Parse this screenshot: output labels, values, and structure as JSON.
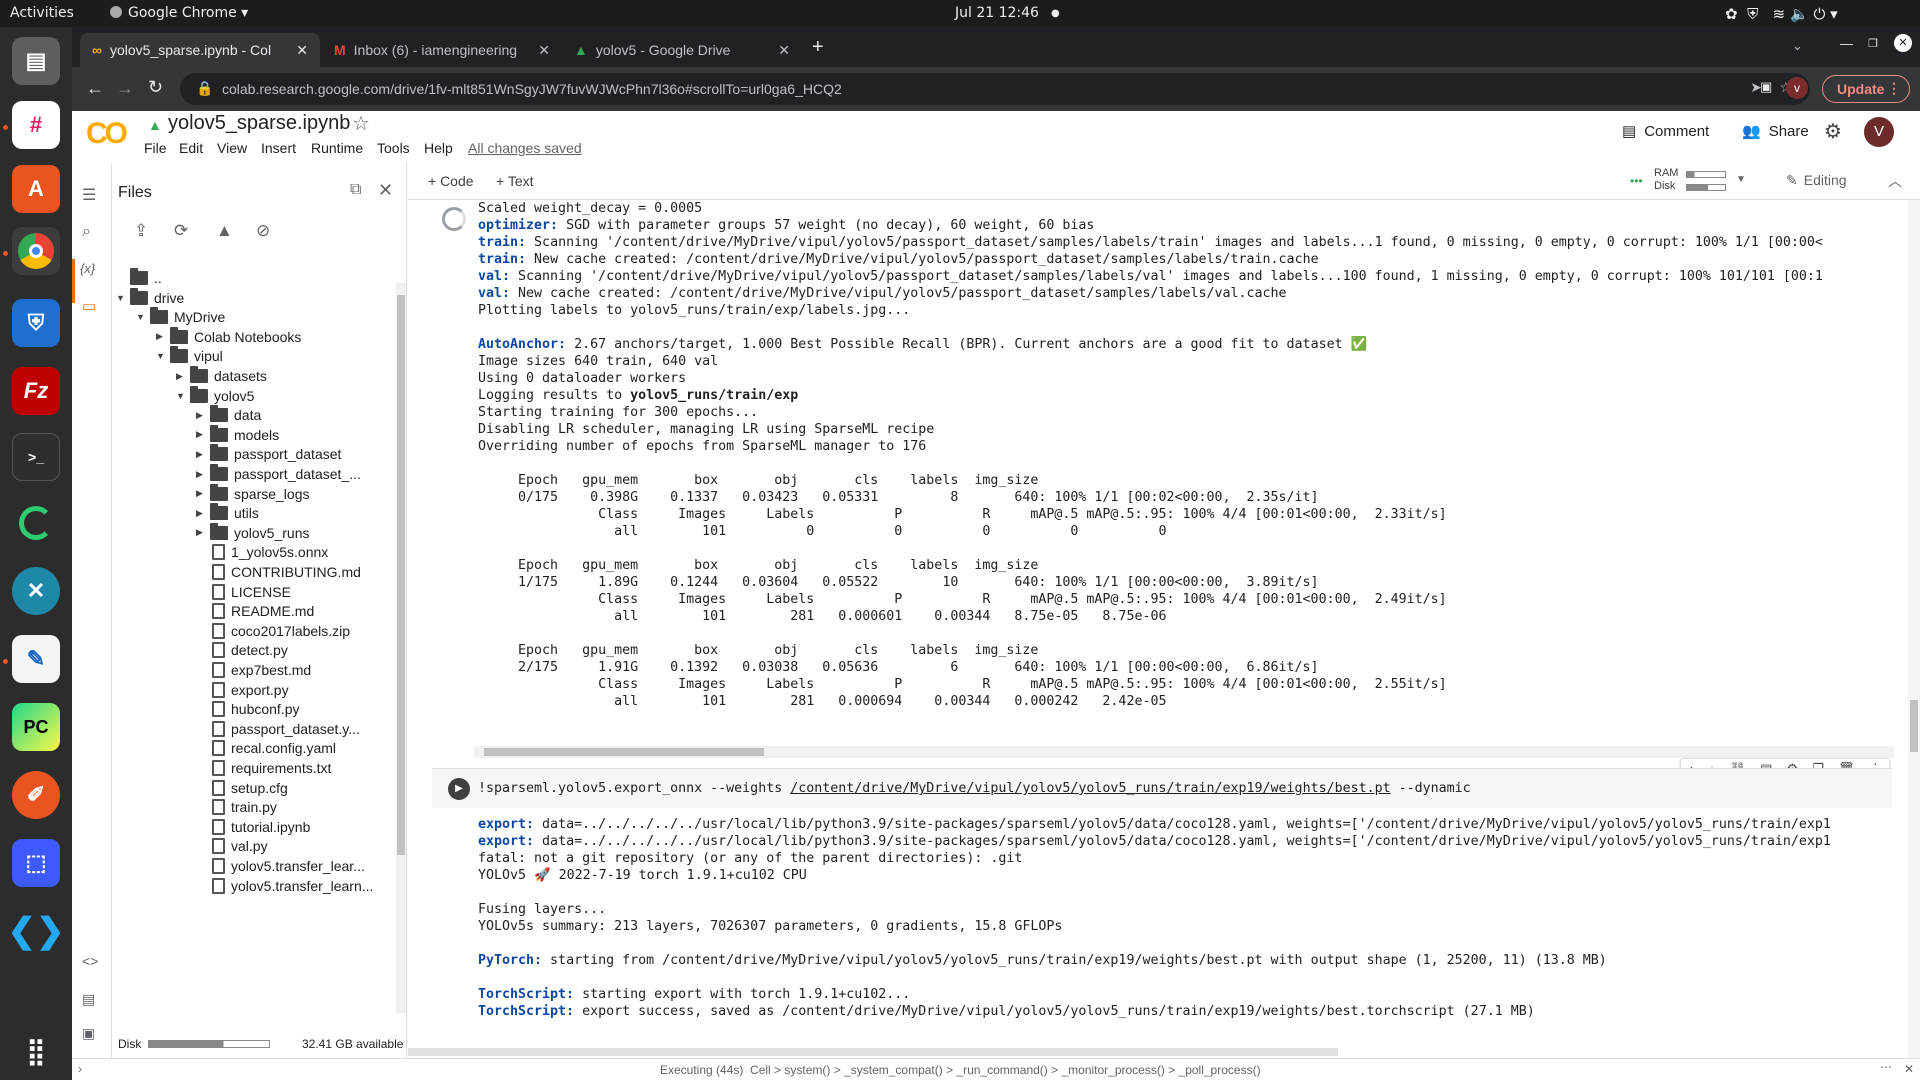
{
  "system_bar": {
    "activities": "Activities",
    "app_name": "Google Chrome",
    "datetime": "Jul 21  12:46"
  },
  "browser": {
    "tabs": [
      {
        "label": "yolov5_sparse.ipynb - Col",
        "icon": "colab-icon",
        "active": true
      },
      {
        "label": "Inbox (6) - iamengineering",
        "icon": "gmail-icon",
        "active": false
      },
      {
        "label": "yolov5 - Google Drive",
        "icon": "drive-icon",
        "active": false
      }
    ],
    "url": "colab.research.google.com/drive/1fv-mlt851WnSgyJW7fuvWJWcPhn7l36o#scrollTo=url0ga6_HCQ2",
    "update_label": "Update",
    "profile_initial": "v"
  },
  "colab": {
    "logo": "CO",
    "notebook_title": "yolov5_sparse.ipynb",
    "menu": [
      "File",
      "Edit",
      "View",
      "Insert",
      "Runtime",
      "Tools",
      "Help"
    ],
    "saved_status": "All changes saved",
    "comment_label": "Comment",
    "share_label": "Share",
    "avatar_initial": "V",
    "add_code": "+ Code",
    "add_text": "+ Text",
    "ram_label": "RAM",
    "disk_label": "Disk",
    "editing_label": "Editing"
  },
  "files_panel": {
    "title": "Files",
    "tree": [
      {
        "label": "..",
        "depth": 0,
        "type": "up"
      },
      {
        "label": "drive",
        "depth": 0,
        "type": "folder",
        "open": true
      },
      {
        "label": "MyDrive",
        "depth": 1,
        "type": "folder",
        "open": true
      },
      {
        "label": "Colab Notebooks",
        "depth": 2,
        "type": "folder",
        "open": false
      },
      {
        "label": "vipul",
        "depth": 2,
        "type": "folder",
        "open": true
      },
      {
        "label": "datasets",
        "depth": 3,
        "type": "folder",
        "open": false
      },
      {
        "label": "yolov5",
        "depth": 3,
        "type": "folder",
        "open": true
      },
      {
        "label": "data",
        "depth": 4,
        "type": "folder",
        "open": false
      },
      {
        "label": "models",
        "depth": 4,
        "type": "folder",
        "open": false
      },
      {
        "label": "passport_dataset",
        "depth": 4,
        "type": "folder",
        "open": false
      },
      {
        "label": "passport_dataset_...",
        "depth": 4,
        "type": "folder",
        "open": false
      },
      {
        "label": "sparse_logs",
        "depth": 4,
        "type": "folder",
        "open": false
      },
      {
        "label": "utils",
        "depth": 4,
        "type": "folder",
        "open": false
      },
      {
        "label": "yolov5_runs",
        "depth": 4,
        "type": "folder",
        "open": false
      },
      {
        "label": "1_yolov5s.onnx",
        "depth": 4,
        "type": "file"
      },
      {
        "label": "CONTRIBUTING.md",
        "depth": 4,
        "type": "file"
      },
      {
        "label": "LICENSE",
        "depth": 4,
        "type": "file"
      },
      {
        "label": "README.md",
        "depth": 4,
        "type": "file"
      },
      {
        "label": "coco2017labels.zip",
        "depth": 4,
        "type": "file"
      },
      {
        "label": "detect.py",
        "depth": 4,
        "type": "file"
      },
      {
        "label": "exp7best.md",
        "depth": 4,
        "type": "file"
      },
      {
        "label": "export.py",
        "depth": 4,
        "type": "file"
      },
      {
        "label": "hubconf.py",
        "depth": 4,
        "type": "file"
      },
      {
        "label": "passport_dataset.y...",
        "depth": 4,
        "type": "file"
      },
      {
        "label": "recal.config.yaml",
        "depth": 4,
        "type": "file"
      },
      {
        "label": "requirements.txt",
        "depth": 4,
        "type": "file"
      },
      {
        "label": "setup.cfg",
        "depth": 4,
        "type": "file"
      },
      {
        "label": "train.py",
        "depth": 4,
        "type": "file"
      },
      {
        "label": "tutorial.ipynb",
        "depth": 4,
        "type": "file"
      },
      {
        "label": "val.py",
        "depth": 4,
        "type": "file"
      },
      {
        "label": "yolov5.transfer_lear...",
        "depth": 4,
        "type": "file"
      },
      {
        "label": "yolov5.transfer_learn...",
        "depth": 4,
        "type": "file"
      }
    ],
    "disk_label": "Disk",
    "disk_free": "32.41 GB available"
  },
  "output1": [
    {
      "k": "",
      "t": "Scaled weight_decay = 0.0005"
    },
    {
      "k": "optimizer:",
      "t": " SGD with parameter groups 57 weight (no decay), 60 weight, 60 bias"
    },
    {
      "k": "train:",
      "t": " Scanning '/content/drive/MyDrive/vipul/yolov5/passport_dataset/samples/labels/train' images and labels...1 found, 0 missing, 0 empty, 0 corrupt: 100% 1/1 [00:00<"
    },
    {
      "k": "train:",
      "t": " New cache created: /content/drive/MyDrive/vipul/yolov5/passport_dataset/samples/labels/train.cache"
    },
    {
      "k": "val:",
      "t": " Scanning '/content/drive/MyDrive/vipul/yolov5/passport_dataset/samples/labels/val' images and labels...100 found, 1 missing, 0 empty, 0 corrupt: 100% 101/101 [00:1"
    },
    {
      "k": "val:",
      "t": " New cache created: /content/drive/MyDrive/vipul/yolov5/passport_dataset/samples/labels/val.cache"
    },
    {
      "k": "",
      "t": "Plotting labels to yolov5_runs/train/exp/labels.jpg..."
    },
    {
      "k": "",
      "t": ""
    },
    {
      "k": "AutoAnchor:",
      "t": " 2.67 anchors/target, 1.000 Best Possible Recall (BPR). Current anchors are a good fit to dataset ✅"
    },
    {
      "k": "",
      "t": "Image sizes 640 train, 640 val"
    },
    {
      "k": "",
      "t": "Using 0 dataloader workers"
    },
    {
      "k": "",
      "t": "Logging results to ",
      "b": "yolov5_runs/train/exp"
    },
    {
      "k": "",
      "t": "Starting training for 300 epochs..."
    },
    {
      "k": "",
      "t": "Disabling LR scheduler, managing LR using SparseML recipe"
    },
    {
      "k": "",
      "t": "Overriding number of epochs from SparseML manager to 176"
    },
    {
      "k": "",
      "t": ""
    },
    {
      "k": "",
      "t": "     Epoch   gpu_mem       box       obj       cls    labels  img_size"
    },
    {
      "k": "",
      "t": "     0/175    0.398G    0.1337   0.03423   0.05331         8       640: 100% 1/1 [00:02<00:00,  2.35s/it]"
    },
    {
      "k": "",
      "t": "               Class     Images     Labels          P          R     mAP@.5 mAP@.5:.95: 100% 4/4 [00:01<00:00,  2.33it/s]"
    },
    {
      "k": "",
      "t": "                 all        101          0          0          0          0          0"
    },
    {
      "k": "",
      "t": ""
    },
    {
      "k": "",
      "t": "     Epoch   gpu_mem       box       obj       cls    labels  img_size"
    },
    {
      "k": "",
      "t": "     1/175     1.89G    0.1244   0.03604   0.05522        10       640: 100% 1/1 [00:00<00:00,  3.89it/s]"
    },
    {
      "k": "",
      "t": "               Class     Images     Labels          P          R     mAP@.5 mAP@.5:.95: 100% 4/4 [00:01<00:00,  2.49it/s]"
    },
    {
      "k": "",
      "t": "                 all        101        281   0.000601    0.00344   8.75e-05   8.75e-06"
    },
    {
      "k": "",
      "t": ""
    },
    {
      "k": "",
      "t": "     Epoch   gpu_mem       box       obj       cls    labels  img_size"
    },
    {
      "k": "",
      "t": "     2/175     1.91G    0.1392   0.03038   0.05636         6       640: 100% 1/1 [00:00<00:00,  6.86it/s]"
    },
    {
      "k": "",
      "t": "               Class     Images     Labels          P          R     mAP@.5 mAP@.5:.95: 100% 4/4 [00:01<00:00,  2.55it/s]"
    },
    {
      "k": "",
      "t": "                 all        101        281   0.000694    0.00344   0.000242   2.42e-05"
    }
  ],
  "cell2": {
    "prefix": "!sparseml.yolov5.export_onnx --weights ",
    "path": "/content/drive/MyDrive/vipul/yolov5/yolov5_runs/train/exp19/weights/best.pt",
    "suffix": " --dynamic"
  },
  "output2": [
    {
      "k": "export:",
      "t": " data=../../../../../usr/local/lib/python3.9/site-packages/sparseml/yolov5/data/coco128.yaml, weights=['/content/drive/MyDrive/vipul/yolov5/yolov5_runs/train/exp1"
    },
    {
      "k": "export:",
      "t": " data=../../../../../usr/local/lib/python3.9/site-packages/sparseml/yolov5/data/coco128.yaml, weights=['/content/drive/MyDrive/vipul/yolov5/yolov5_runs/train/exp1"
    },
    {
      "k": "",
      "t": "fatal: not a git repository (or any of the parent directories): .git"
    },
    {
      "k": "",
      "t": "YOLOv5 🚀 2022-7-19 torch 1.9.1+cu102 CPU"
    },
    {
      "k": "",
      "t": ""
    },
    {
      "k": "",
      "t": "Fusing layers..."
    },
    {
      "k": "",
      "t": "YOLOv5s summary: 213 layers, 7026307 parameters, 0 gradients, 15.8 GFLOPs"
    },
    {
      "k": "",
      "t": ""
    },
    {
      "k": "PyTorch:",
      "t": " starting from /content/drive/MyDrive/vipul/yolov5/yolov5_runs/train/exp19/weights/best.pt with output shape (1, 25200, 11) (13.8 MB)"
    },
    {
      "k": "",
      "t": ""
    },
    {
      "k": "TorchScript:",
      "t": " starting export with torch 1.9.1+cu102..."
    },
    {
      "k": "TorchScript:",
      "t": " export success, saved as /content/drive/MyDrive/vipul/yolov5/yolov5_runs/train/exp19/weights/best.torchscript (27.1 MB)"
    }
  ],
  "status": {
    "text": "Executing (44s)  Cell > system() > _system_compat() > _run_command() > _monitor_process() > _poll_process()"
  }
}
